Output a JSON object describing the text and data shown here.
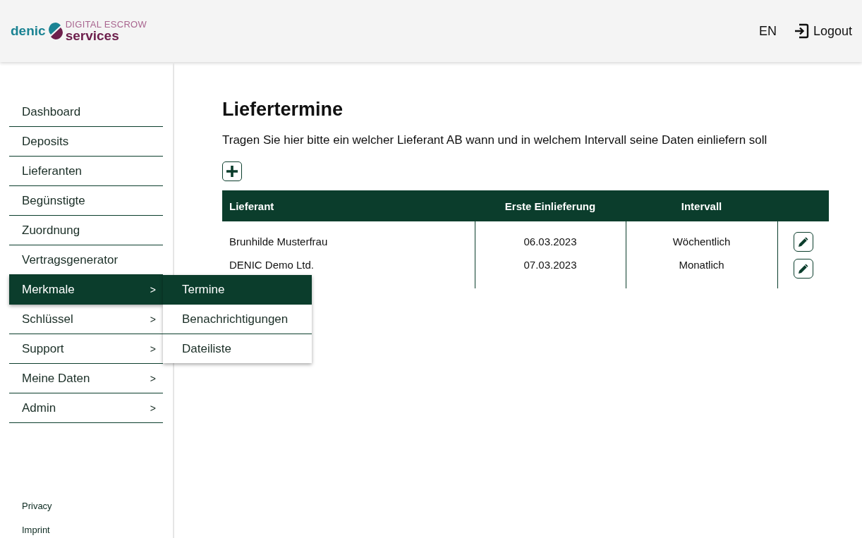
{
  "header": {
    "logo": {
      "brand": "denic",
      "tagline": "DIGITAL ESCROW",
      "product": "services"
    },
    "language": "EN",
    "logout": "Logout"
  },
  "sidebar": {
    "items": [
      {
        "label": "Dashboard",
        "selected": false
      },
      {
        "label": "Deposits",
        "selected": false
      },
      {
        "label": "Lieferanten",
        "selected": false
      },
      {
        "label": "Begünstigte",
        "selected": false
      },
      {
        "label": "Zuordnung",
        "selected": false
      },
      {
        "label": "Vertragsgenerator",
        "selected": false
      },
      {
        "label": "Merkmale",
        "selected": true,
        "arrow": ">",
        "expanded": true,
        "children": [
          {
            "label": "Termine",
            "selected": true
          },
          {
            "label": "Benachrichtigungen",
            "selected": false
          },
          {
            "label": "Dateiliste",
            "selected": false
          }
        ]
      },
      {
        "label": "Schlüssel",
        "selected": false,
        "arrow": ">"
      },
      {
        "label": "Support",
        "selected": false,
        "arrow": ">"
      },
      {
        "label": "Meine Daten",
        "selected": false,
        "arrow": ">"
      },
      {
        "label": "Admin",
        "selected": false,
        "arrow": ">"
      }
    ],
    "footer_links": [
      "Privacy",
      "Imprint"
    ]
  },
  "main": {
    "title": "Liefertermine",
    "description": "Tragen Sie hier bitte ein welcher Lieferant AB wann und in welchem Intervall seine Daten einliefern soll",
    "table": {
      "columns": [
        "Lieferant",
        "Erste Einlieferung",
        "Intervall"
      ],
      "rows": [
        {
          "cells": [
            "Brunhilde Musterfrau",
            "06.03.2023",
            "Wöchentlich"
          ]
        },
        {
          "cells": [
            "DENIC Demo Ltd.",
            "07.03.2023",
            "Monatlich"
          ]
        }
      ]
    }
  }
}
